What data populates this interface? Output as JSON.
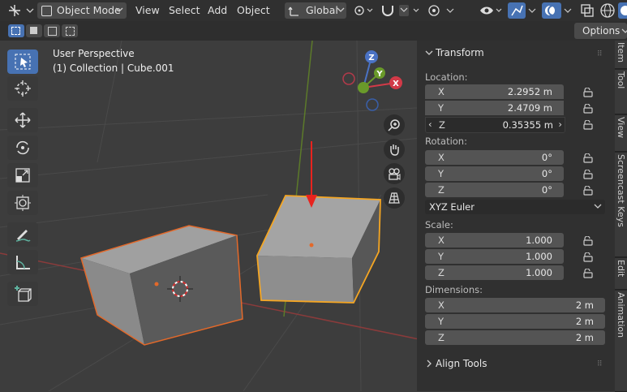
{
  "header": {
    "mode": "Object Mode",
    "menus": [
      "View",
      "Select",
      "Add",
      "Object"
    ],
    "orientation": "Global",
    "options": "Options"
  },
  "viewport": {
    "perspective": "User Perspective",
    "collection": "(1) Collection | Cube.001",
    "gizmo": {
      "x": "X",
      "y": "Y",
      "z": "Z"
    }
  },
  "transform": {
    "title": "Transform",
    "location_label": "Location:",
    "location": [
      {
        "axis": "X",
        "value": "2.2952 m"
      },
      {
        "axis": "Y",
        "value": "2.4709 m"
      },
      {
        "axis": "Z",
        "value": "0.35355 m"
      }
    ],
    "rotation_label": "Rotation:",
    "rotation": [
      {
        "axis": "X",
        "value": "0°"
      },
      {
        "axis": "Y",
        "value": "0°"
      },
      {
        "axis": "Z",
        "value": "0°"
      }
    ],
    "rotation_mode": "XYZ Euler",
    "scale_label": "Scale:",
    "scale": [
      {
        "axis": "X",
        "value": "1.000"
      },
      {
        "axis": "Y",
        "value": "1.000"
      },
      {
        "axis": "Z",
        "value": "1.000"
      }
    ],
    "dimensions_label": "Dimensions:",
    "dimensions": [
      {
        "axis": "X",
        "value": "2 m"
      },
      {
        "axis": "Y",
        "value": "2 m"
      },
      {
        "axis": "Z",
        "value": "2 m"
      }
    ]
  },
  "align_tools": "Align Tools",
  "tabs": [
    "Item",
    "Tool",
    "View",
    "Screencast Keys",
    "Edit",
    "Animation"
  ],
  "colors": {
    "accent": "#4772b3",
    "selection": "#f5841f",
    "arrow": "#e8231e"
  }
}
